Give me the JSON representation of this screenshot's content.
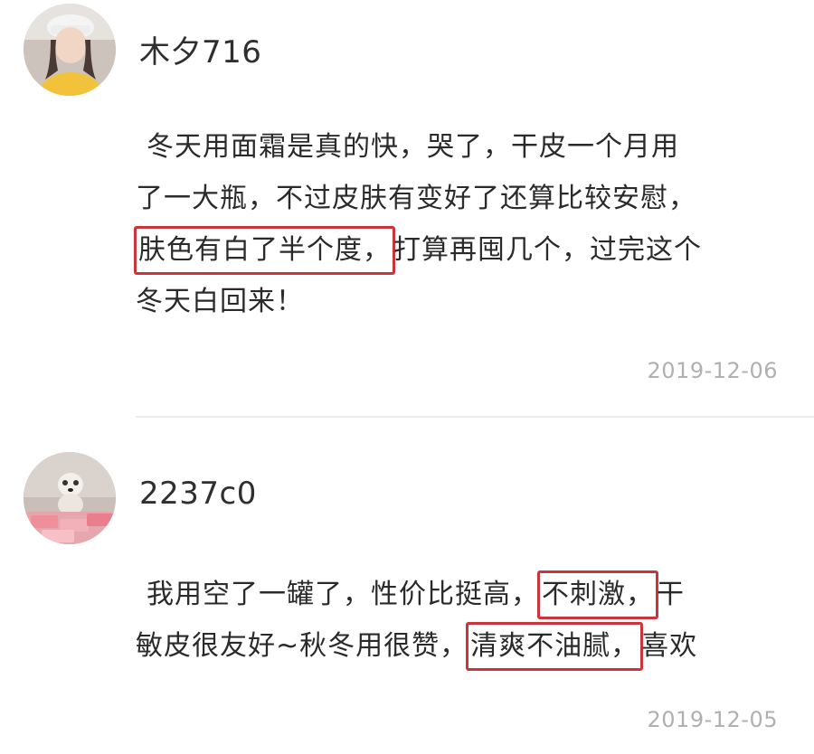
{
  "comments": [
    {
      "username": "木夕716",
      "lines": [
        {
          "pre": "冬天用面霜是真的快，哭了，干皮一个月用",
          "hl": "",
          "post": ""
        },
        {
          "pre": "了一大瓶，不过皮肤有变好了还算比较安慰，",
          "hl": "",
          "post": ""
        },
        {
          "pre": "",
          "hl": "肤色有白了半个度，",
          "post": "打算再囤几个，过完这个"
        },
        {
          "pre": "冬天白回来！",
          "hl": "",
          "post": ""
        }
      ],
      "date": "2019-12-06"
    },
    {
      "username": "2237c0",
      "lines": [
        {
          "pre": "我用空了一罐了，性价比挺高，",
          "hl": "不刺激，",
          "post": "干"
        },
        {
          "pre": "敏皮很友好~秋冬用很赞，",
          "hl": "清爽不油腻，",
          "post": "喜欢"
        }
      ],
      "date": "2019-12-05"
    }
  ],
  "colors": {
    "highlight_border": "#c9353a",
    "date_text": "#b0b0b0",
    "divider": "#ececec"
  }
}
